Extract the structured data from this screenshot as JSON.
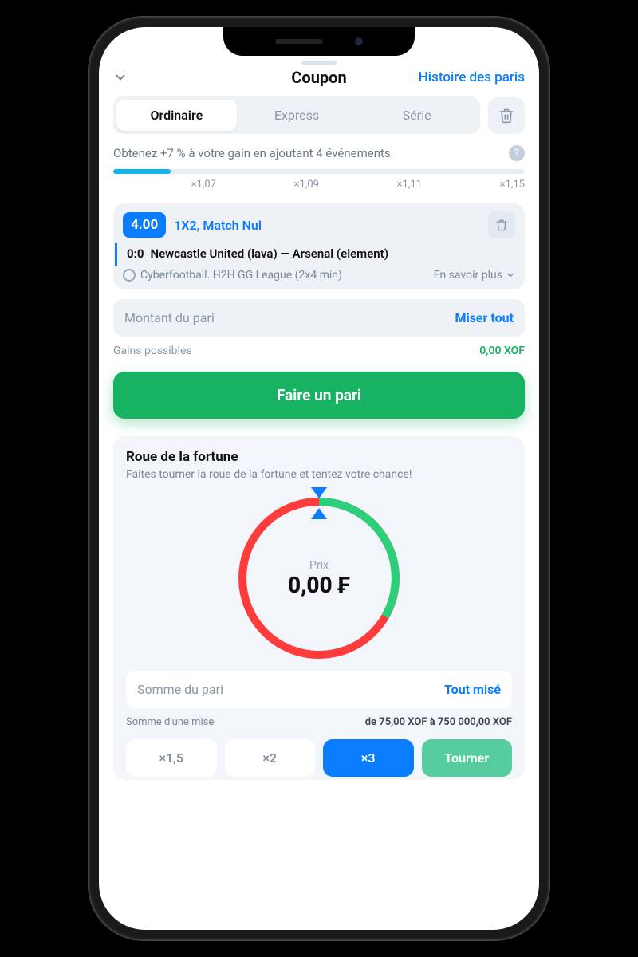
{
  "header": {
    "title": "Coupon",
    "history_link": "Histoire des paris"
  },
  "tabs": {
    "ordinary": "Ordinaire",
    "express": "Express",
    "series": "Série"
  },
  "bonus": {
    "text": "Obtenez +7 % à votre gain en ajoutant 4 événements",
    "multipliers": [
      "×1,07",
      "×1,09",
      "×1,11",
      "×1,15"
    ]
  },
  "bet": {
    "odds": "4.00",
    "market": "1X2, Match Nul",
    "score": "0:0",
    "match": "Newcastle United (lava) — Arsenal (element)",
    "league": "Cyberfootball. H2H GG League (2x4 min)",
    "more": "En savoir plus"
  },
  "amount": {
    "placeholder": "Montant du pari",
    "bet_all": "Miser tout",
    "possible_label": "Gains possibles",
    "possible_value": "0,00 XOF"
  },
  "place_button": "Faire un pari",
  "wheel": {
    "title": "Roue de la fortune",
    "subtitle": "Faites tourner la roue de la fortune et tentez votre chance!",
    "price_label": "Prix",
    "price_value": "0,00 ₣",
    "stake_placeholder": "Somme du pari",
    "bet_all": "Tout misé",
    "range_label": "Somme d'une mise",
    "range_value": "de 75,00 XOF à 750 000,00 XOF",
    "chips": {
      "a": "×1,5",
      "b": "×2",
      "c": "×3",
      "spin": "Tourner"
    }
  }
}
